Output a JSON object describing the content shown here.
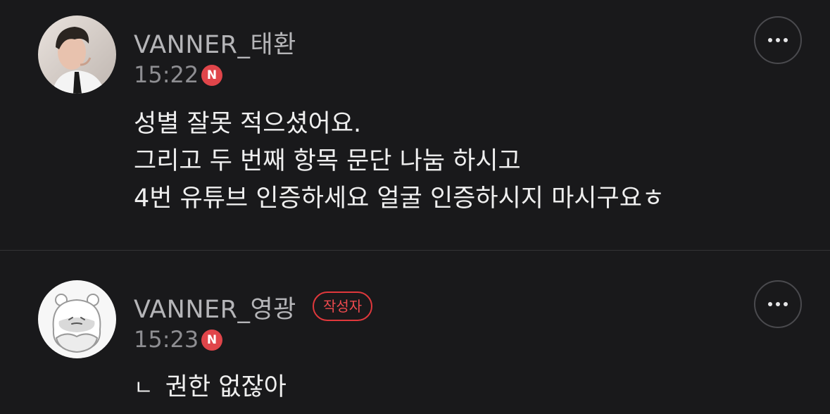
{
  "comments": [
    {
      "username": "VANNER_태환",
      "time": "15:22",
      "new_badge": "N",
      "lines": [
        "성별 잘못 적으셨어요.",
        "그리고 두 번째 항목 문단 나눔 하시고",
        "4번 유튜브 인증하세요 얼굴 인증하시지 마시구요ㅎ"
      ],
      "avatar": "photo-avatar"
    },
    {
      "username": "VANNER_영광",
      "author_badge": "작성자",
      "time": "15:23",
      "new_badge": "N",
      "reply_mark": "ㄴ",
      "lines": [
        "권한 없잖아"
      ],
      "avatar": "character-avatar"
    }
  ],
  "colors": {
    "background": "#19191b",
    "accent_red": "#e0454a",
    "username_gray": "#b5b5b8",
    "time_gray": "#8e8e92",
    "text": "#efefef"
  },
  "icons": {
    "more": "more-horizontal-icon"
  }
}
